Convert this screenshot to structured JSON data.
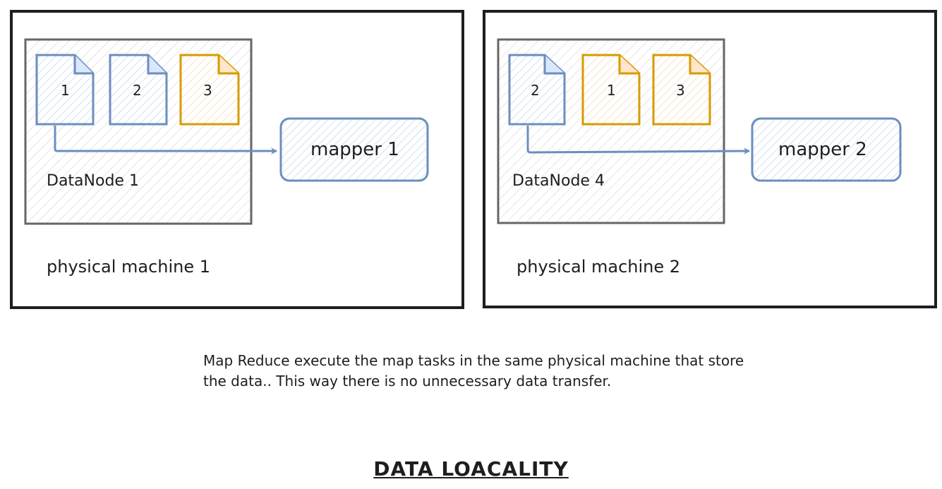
{
  "colors": {
    "blue": "#6c8ebf",
    "blue_fill": "#dae8fc",
    "orange": "#d79b00",
    "orange_fill": "#ffe6cc",
    "gray": "#666666",
    "black": "#1e1e1e"
  },
  "machines": [
    {
      "label": "physical machine 1",
      "datanode": {
        "label": "DataNode 1",
        "docs": [
          {
            "num": "1",
            "color": "blue"
          },
          {
            "num": "2",
            "color": "blue"
          },
          {
            "num": "3",
            "color": "orange"
          }
        ]
      },
      "mapper": "mapper 1"
    },
    {
      "label": "physical machine 2",
      "datanode": {
        "label": "DataNode 4",
        "docs": [
          {
            "num": "2",
            "color": "blue"
          },
          {
            "num": "1",
            "color": "orange"
          },
          {
            "num": "3",
            "color": "orange"
          }
        ]
      },
      "mapper": "mapper 2"
    }
  ],
  "caption": "Map Reduce execute the map tasks in the same physical machine that store the data.. This way there is no unnecessary data transfer.",
  "title": "DATA LOACALITY"
}
